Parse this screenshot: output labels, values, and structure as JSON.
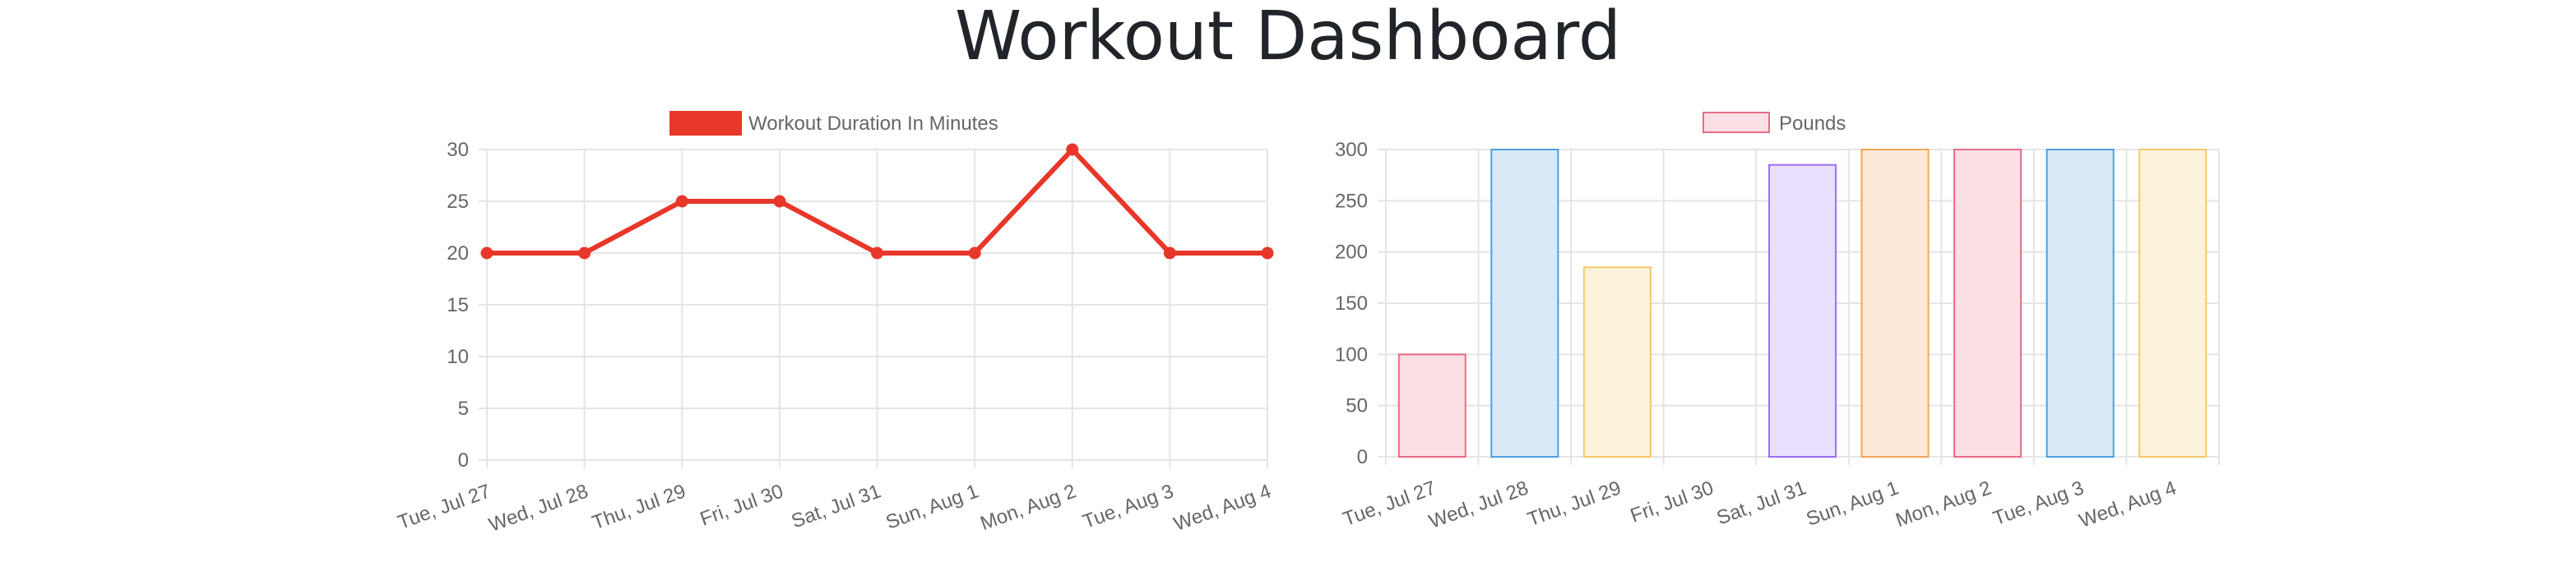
{
  "page": {
    "title": "Workout Dashboard"
  },
  "chart_data": [
    {
      "type": "line",
      "categories": [
        "Tue, Jul 27",
        "Wed, Jul 28",
        "Thu, Jul 29",
        "Fri, Jul 30",
        "Sat, Jul 31",
        "Sun, Aug 1",
        "Mon, Aug 2",
        "Tue, Aug 3",
        "Wed, Aug 4"
      ],
      "series": [
        {
          "name": "Workout Duration In Minutes",
          "values": [
            20,
            20,
            25,
            25,
            20,
            20,
            30,
            20,
            20
          ],
          "color": "#e8372a"
        }
      ],
      "ylim": [
        0,
        30
      ],
      "yticks": [
        0,
        5,
        10,
        15,
        20,
        25,
        30
      ],
      "grid": true,
      "legend": "top-center"
    },
    {
      "type": "bar",
      "categories": [
        "Tue, Jul 27",
        "Wed, Jul 28",
        "Thu, Jul 29",
        "Fri, Jul 30",
        "Sat, Jul 31",
        "Sun, Aug 1",
        "Mon, Aug 2",
        "Tue, Aug 3",
        "Wed, Aug 4"
      ],
      "series": [
        {
          "name": "Pounds",
          "values": [
            100,
            300,
            185,
            0,
            285,
            300,
            300,
            300,
            300
          ]
        }
      ],
      "bar_fills": [
        "#fadfe5",
        "#d8eaf8",
        "#fdf3dd",
        "#e4f4f4",
        "#e8e0fd",
        "#fde9d8",
        "#fadfe5",
        "#d8eaf8",
        "#fdf3dd"
      ],
      "bar_strokes": [
        "#e66c87",
        "#4f9ee4",
        "#f5c86a",
        "#6cc6c6",
        "#9a6ef5",
        "#f2a55a",
        "#e66c87",
        "#4f9ee4",
        "#f5c86a"
      ],
      "legend_fill": "#fadfe5",
      "legend_stroke": "#e66c87",
      "ylim": [
        0,
        300
      ],
      "yticks": [
        0,
        50,
        100,
        150,
        200,
        250,
        300
      ],
      "grid": true,
      "legend": "top-center"
    }
  ]
}
